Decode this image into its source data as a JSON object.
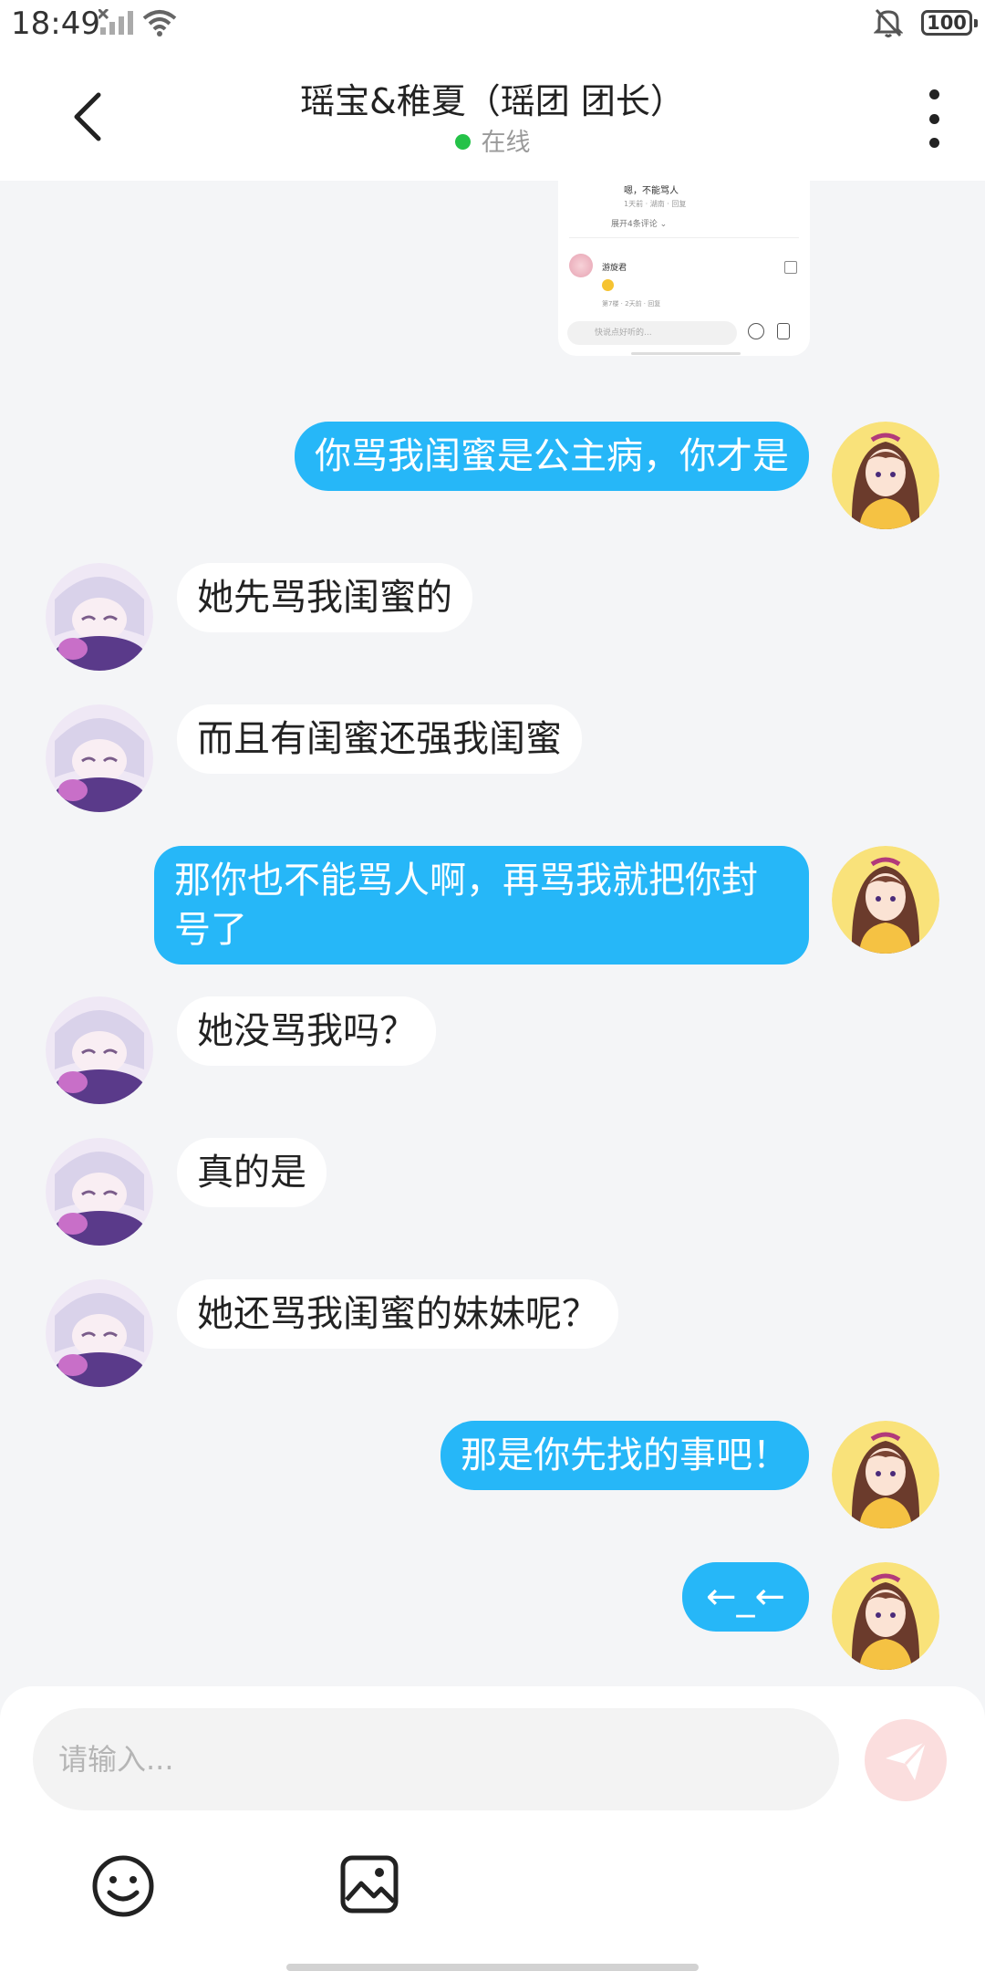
{
  "status_bar": {
    "time": "18:49",
    "battery": "100"
  },
  "header": {
    "title": "瑶宝&稚夏（瑶团 团长）",
    "status": "在线"
  },
  "screenshot_card": {
    "line1": "嗯，不能骂人",
    "line2": "1天前 · 湖南 · 回复",
    "line3": "展开4条评论 ⌄",
    "user": "游旋君",
    "meta": "第7楼 · 2天前 · 回复",
    "input_placeholder": "快说点好听的..."
  },
  "messages": [
    {
      "side": "me",
      "text": "你骂我闺蜜是公主病，你才是"
    },
    {
      "side": "other",
      "text": "她先骂我闺蜜的"
    },
    {
      "side": "other",
      "text": "而且有闺蜜还强我闺蜜"
    },
    {
      "side": "me",
      "text": "那你也不能骂人啊，再骂我就把你封号了"
    },
    {
      "side": "other",
      "text": "她没骂我吗？"
    },
    {
      "side": "other",
      "text": "真的是"
    },
    {
      "side": "other",
      "text": "她还骂我闺蜜的妹妹呢？"
    },
    {
      "side": "me",
      "text": "那是你先找的事吧！"
    },
    {
      "side": "me",
      "text": "←_←"
    }
  ],
  "composer": {
    "placeholder": "请输入..."
  },
  "icons": {
    "back": "back-arrow-icon",
    "more": "more-vertical-icon",
    "send": "send-icon",
    "emoji": "emoji-icon",
    "image": "image-icon"
  },
  "colors": {
    "my_bubble": "#26b7f8",
    "other_bubble": "#ffffff",
    "online": "#24c248",
    "send_btn": "#fbdede"
  }
}
